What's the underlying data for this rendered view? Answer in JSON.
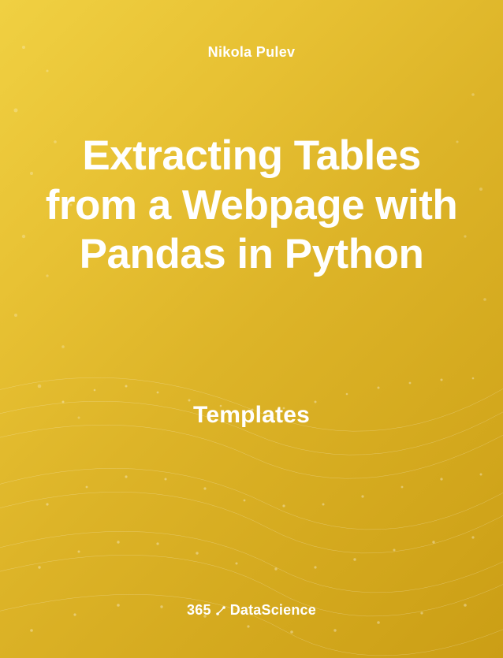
{
  "author": "Nikola Pulev",
  "title": "Extracting Tables from a Webpage with Pandas in Python",
  "subtitle": "Templates",
  "logo": {
    "prefix": "365",
    "suffix": "DataScience"
  }
}
